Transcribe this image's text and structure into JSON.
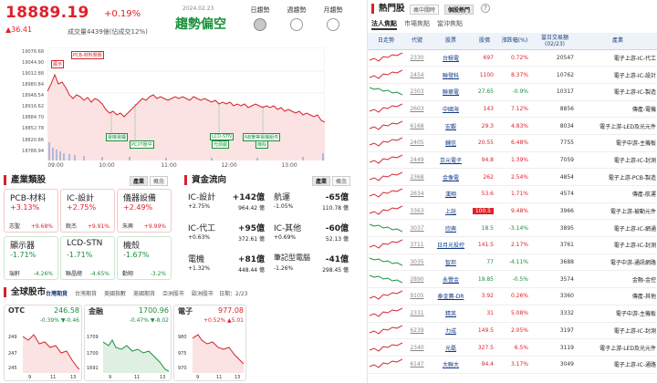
{
  "header": {
    "index_value": "18889.19",
    "index_pct": "+0.19%",
    "index_change": "▲36.41",
    "volume": "成交量4439億(佔成交12%)",
    "date": "2024.02.23",
    "trend": "趨勢偏空",
    "indicators": [
      {
        "label": "日趨勢"
      },
      {
        "label": "週趨勢"
      },
      {
        "label": "月趨勢"
      }
    ]
  },
  "main_chart": {
    "y_labels": [
      "19076.68",
      "19044.90",
      "19012.88",
      "18980.84",
      "18948.54",
      "18916.62",
      "18884.70",
      "18852.78",
      "18820.86",
      "18788.94"
    ],
    "x_labels": [
      "09:00",
      "10:00",
      "11:00",
      "12:00",
      "13:00"
    ],
    "tags": [
      "PCB-材料題題",
      "展示",
      "電機電纜",
      "PC/IT壓中",
      "LCD-STN",
      "光頭戲",
      "NB筆等電機組件",
      "機殼"
    ]
  },
  "industry": {
    "title": "產業類股",
    "btn1": "產業",
    "btn2": "概念",
    "cards": [
      {
        "name": "PCB-材料",
        "pct": "+3.13%",
        "sub": "志聖",
        "sub_pct": "+9.68%"
      },
      {
        "name": "IC-設計",
        "pct": "+2.75%",
        "sub": "銳杰",
        "sub_pct": "+9.91%"
      },
      {
        "name": "儀器設備",
        "pct": "+2.49%",
        "sub": "朱興",
        "sub_pct": "+9.99%"
      },
      {
        "name": "顯示器",
        "pct": "-1.71%",
        "sub": "瑞軒",
        "sub_pct": "-4.26%"
      },
      {
        "name": "LCD-STN",
        "pct": "-1.71%",
        "sub": "聯晶總",
        "sub_pct": "-4.65%"
      },
      {
        "name": "機殼",
        "pct": "-1.67%",
        "sub": "勤翔",
        "sub_pct": "-3.2%"
      }
    ]
  },
  "funds": {
    "title": "資金流向",
    "btn1": "產業",
    "btn2": "概念",
    "items": [
      {
        "name": "IC-設計",
        "pct": "+2.75%",
        "val": "+142億",
        "sub": "964.42 億"
      },
      {
        "name": "航運",
        "pct": "-1.05%",
        "val": "-65億",
        "sub": "110.78 億"
      },
      {
        "name": "IC-代工",
        "pct": "+0.63%",
        "val": "+95億",
        "sub": "372.61 億"
      },
      {
        "name": "IC-其他",
        "pct": "+0.69%",
        "val": "-60億",
        "sub": "52.13 億"
      },
      {
        "name": "電機",
        "pct": "+1.32%",
        "val": "+81億",
        "sub": "448.44 億"
      },
      {
        "name": "筆記型電腦",
        "pct": "-1.26%",
        "val": "-41億",
        "sub": "298.45 億"
      }
    ]
  },
  "global": {
    "title": "全球股市",
    "tabs": [
      "台灣期貨",
      "台灣期貨",
      "美國指數",
      "美國期貨",
      "亞洲股市",
      "歐洲股市",
      "日期：2/23"
    ],
    "minis": [
      {
        "name": "OTC",
        "value": "246.58",
        "pct": "-0.39%",
        "chg": "▼-0.46",
        "y": [
          "249",
          "247",
          "245"
        ],
        "x": [
          "9",
          "11",
          "13"
        ]
      },
      {
        "name": "金融",
        "value": "1700.96",
        "pct": "-0.47%",
        "chg": "▼-8.02",
        "y": [
          "1709",
          "1700",
          "1691"
        ],
        "x": [
          "9",
          "11",
          "13"
        ]
      },
      {
        "name": "電子",
        "value": "977.08",
        "pct": "+0.52%",
        "chg": "▲5.01",
        "y": [
          "980",
          "975",
          "970"
        ],
        "x": [
          "9",
          "11",
          "13"
        ]
      }
    ]
  },
  "hot": {
    "title": "熱門股",
    "tabs": [
      "瘋中闊時",
      "個股熱門"
    ],
    "subtabs": [
      "法人焦點",
      "市場焦點",
      "當沖焦點"
    ],
    "columns": [
      "日走勢",
      "代號",
      "股票",
      "股價",
      "漲跌幅(%)",
      "當日交易額(02/23)",
      "產業"
    ],
    "rows": [
      {
        "code": "2330",
        "name": "台積電",
        "price": "697",
        "pct": "0.72%",
        "vol": "20547",
        "ind": "電子上游-IC-代工",
        "dir": "up"
      },
      {
        "code": "2454",
        "name": "聯發科",
        "price": "1100",
        "pct": "8.37%",
        "vol": "10762",
        "ind": "電子上游-IC-設計",
        "dir": "up"
      },
      {
        "code": "2303",
        "name": "聯華電",
        "price": "27.65",
        "pct": "-0.9%",
        "vol": "10317",
        "ind": "電子上游-IC-製造",
        "dir": "dn"
      },
      {
        "code": "2603",
        "name": "中國海",
        "price": "143",
        "pct": "7.12%",
        "vol": "8856",
        "ind": "傳產-電機",
        "dir": "up"
      },
      {
        "code": "6168",
        "name": "宏觀",
        "price": "29.3",
        "pct": "4.83%",
        "vol": "8034",
        "ind": "電子上游-LED及光元件",
        "dir": "up"
      },
      {
        "code": "2405",
        "name": "輔信",
        "price": "20.55",
        "pct": "6.48%",
        "vol": "7755",
        "ind": "電子中游-主機板",
        "dir": "up"
      },
      {
        "code": "2449",
        "name": "京元電子",
        "price": "94.8",
        "pct": "1.39%",
        "vol": "7059",
        "ind": "電子上游-IC-封測",
        "dir": "up"
      },
      {
        "code": "2368",
        "name": "金像電",
        "price": "262",
        "pct": "2.54%",
        "vol": "4854",
        "ind": "電子上游-PCB-製造",
        "dir": "up"
      },
      {
        "code": "2634",
        "name": "漢翔",
        "price": "53.6",
        "pct": "1.71%",
        "vol": "4574",
        "ind": "傳產-航運",
        "dir": "up"
      },
      {
        "code": "3363",
        "name": "上詮",
        "price": "100.5",
        "pct": "9.48%",
        "vol": "3966",
        "ind": "電子上游-被動元件",
        "dir": "up",
        "hl": true
      },
      {
        "code": "3037",
        "name": "欣興",
        "price": "18.5",
        "pct": "-3.14%",
        "vol": "3895",
        "ind": "電子上游-IC-網通",
        "dir": "dn"
      },
      {
        "code": "3711",
        "name": "日月光投控",
        "price": "141.5",
        "pct": "2.17%",
        "vol": "3761",
        "ind": "電子上游-IC-封測",
        "dir": "up"
      },
      {
        "code": "3035",
        "name": "智邦",
        "price": "77",
        "pct": "-4.11%",
        "vol": "3688",
        "ind": "電子中游-通訊網路",
        "dir": "dn"
      },
      {
        "code": "2890",
        "name": "永豐金",
        "price": "19.85",
        "pct": "-0.5%",
        "vol": "3574",
        "ind": "金融-金控",
        "dir": "dn"
      },
      {
        "code": "9105",
        "name": "泰金寶-DR",
        "price": "3.92",
        "pod": "",
        "pct": "0.26%",
        "vol": "3360",
        "ind": "傳產-其他",
        "dir": "up"
      },
      {
        "code": "2331",
        "name": "精英",
        "price": "31",
        "pct": "5.08%",
        "vol": "3332",
        "ind": "電子中游-主機板",
        "dir": "up"
      },
      {
        "code": "6239",
        "name": "力成",
        "price": "149.5",
        "pct": "2.05%",
        "vol": "3197",
        "ind": "電子上游-IC-封測",
        "dir": "up"
      },
      {
        "code": "2340",
        "name": "光磊",
        "price": "327.5",
        "pct": "6.5%",
        "vol": "3119",
        "ind": "電子上游-LED及光元件",
        "dir": "up"
      },
      {
        "code": "6147",
        "name": "大聯大",
        "price": "94.4",
        "pct": "3.17%",
        "vol": "3049",
        "ind": "電子上游-IC-通路",
        "dir": "up"
      }
    ]
  },
  "colors": {
    "up": "#e0202a",
    "down": "#1a8f3a",
    "accent": "#d2232a"
  }
}
